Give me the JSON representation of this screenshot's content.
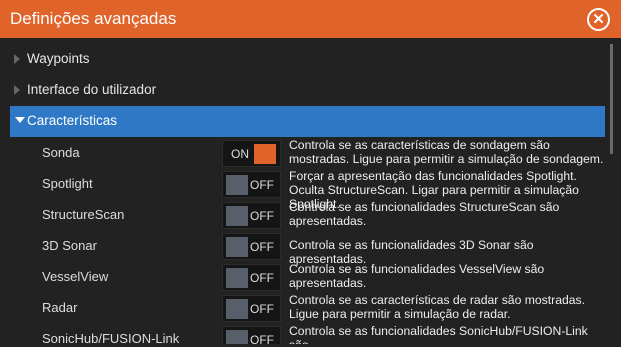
{
  "dialog": {
    "title": "Definições avançadas",
    "close_icon": "close-icon"
  },
  "categories": [
    {
      "label": "Waypoints"
    },
    {
      "label": "Interface do utilizador"
    },
    {
      "label": "Características"
    }
  ],
  "features": [
    {
      "name": "Sonda",
      "state": "ON",
      "on": true,
      "desc": "Controla se as características de sondagem são mostradas. Ligue para permitir a simulação de sondagem."
    },
    {
      "name": "Spotlight",
      "state": "OFF",
      "on": false,
      "desc": "Forçar a apresentação das funcionalidades Spotlight. Oculta StructureScan. Ligar para permitir a simulação Spotlight."
    },
    {
      "name": "StructureScan",
      "state": "OFF",
      "on": false,
      "desc": "Controla se as funcionalidades StructureScan são apresentadas."
    },
    {
      "name": "3D Sonar",
      "state": "OFF",
      "on": false,
      "desc": "Controla se as funcionalidades 3D Sonar são apresentadas."
    },
    {
      "name": "VesselView",
      "state": "OFF",
      "on": false,
      "desc": "Controla se as funcionalidades VesselView são apresentadas."
    },
    {
      "name": "Radar",
      "state": "OFF",
      "on": false,
      "desc": "Controla se as características de radar são mostradas. Ligue para permitir a simulação de radar."
    },
    {
      "name": "SonicHub/FUSION-Link",
      "state": "OFF",
      "on": false,
      "desc": "Controla se as funcionalidades SonicHub/FUSION-Link são"
    }
  ],
  "colors": {
    "accent": "#e0632a",
    "selected": "#2f78c6"
  }
}
